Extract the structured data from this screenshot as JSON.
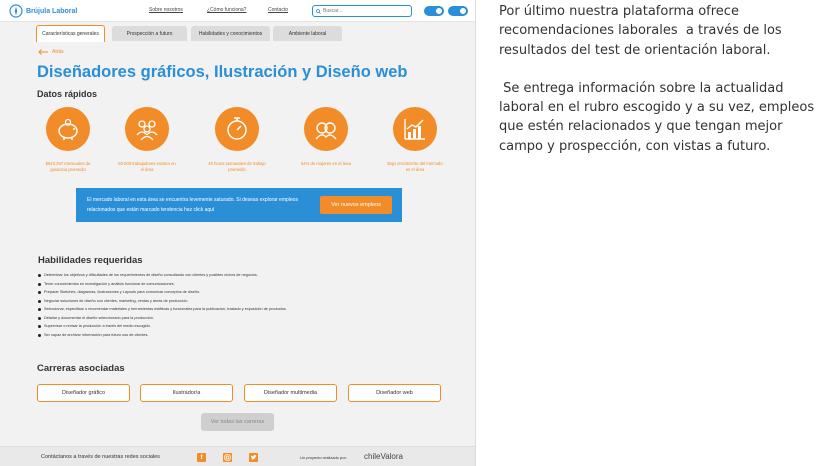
{
  "header": {
    "logo_text": "Brújula Laboral",
    "nav": [
      "Sobre nosotros",
      "¿Cómo funciona?",
      "Contacto"
    ],
    "search_placeholder": "Buscar..."
  },
  "tabs": [
    "Características generales",
    "Prospección a futuro",
    "Habilidades y conocimientos",
    "Ambiente laboral"
  ],
  "back_label": "Atrás",
  "page_title": "Diseñadores gráficos, Ilustración y Diseño web",
  "quick_facts": {
    "heading": "Datos rápidos",
    "items": [
      {
        "icon": "piggy-bank-icon",
        "label": "$643.257 mensuales de ganancia promedio"
      },
      {
        "icon": "workers-icon",
        "label": "50.000 trabajadores existen en el área"
      },
      {
        "icon": "stopwatch-icon",
        "label": "40 horas semanales de trabajo promedio"
      },
      {
        "icon": "women-icon",
        "label": "54% de mujeres en el área"
      },
      {
        "icon": "growth-chart-icon",
        "label": "Bajo crecimiento del mercado en el área"
      }
    ]
  },
  "banner": {
    "text": "El mercado laboral en esta área se encuentra levemente saturado. Si deseas explorar empleos relacionados que están marcado tendencia haz click aquí",
    "button": "Ver nuevos empleos"
  },
  "skills": {
    "heading": "Habilidades requeridas",
    "items": [
      "Determinar los objetivos y dificultades de los requerimientos de diseño consultando con clientes y posibles nichos de negocios.",
      "Tener conocimientos en investigación y análisis funcional de comunicaciones.",
      "Preparar Sketches, diagramas, Ilustraciones y Layouts para comunicar conceptos de diseño.",
      "Negociar soluciones de diseño con clientes, marketing, ventas y áreas de producción.",
      "Seleccionar, especificar o recomendar materiales y herramientas estéticas y funcionales para la publicación, traslado y exposición de productos.",
      "Detallar y documentar el diseño seleccionado para la producción.",
      "Supervisar o revisar la producción a través del medio escogido.",
      "Ser capaz de archivar información para futuro uso de clientes."
    ]
  },
  "careers": {
    "heading": "Carreras asociadas",
    "items": [
      "Diseñador gráfico",
      "Ilustrador/a",
      "Diseñador multimedia",
      "Diseñador web"
    ],
    "all_button": "Ver todas las carreras"
  },
  "footer": {
    "social_text": "Contáctanos a través de nuestras redes sociales",
    "project_text": "Un proyecto realizado por:",
    "brand": "chileValora"
  },
  "side_text": {
    "p1": "Por último nuestra plataforma ofrece recomendaciones laborales  a través de los resultados del test de orientación laboral.",
    "p2": " Se entrega información sobre la actualidad laboral en el rubro escogido y a su vez, empleos que estén relacionados y que tengan mejor campo y prospección, con vistas a futuro."
  },
  "colors": {
    "brand_blue": "#2a8fd6",
    "accent_orange": "#f28c28"
  }
}
